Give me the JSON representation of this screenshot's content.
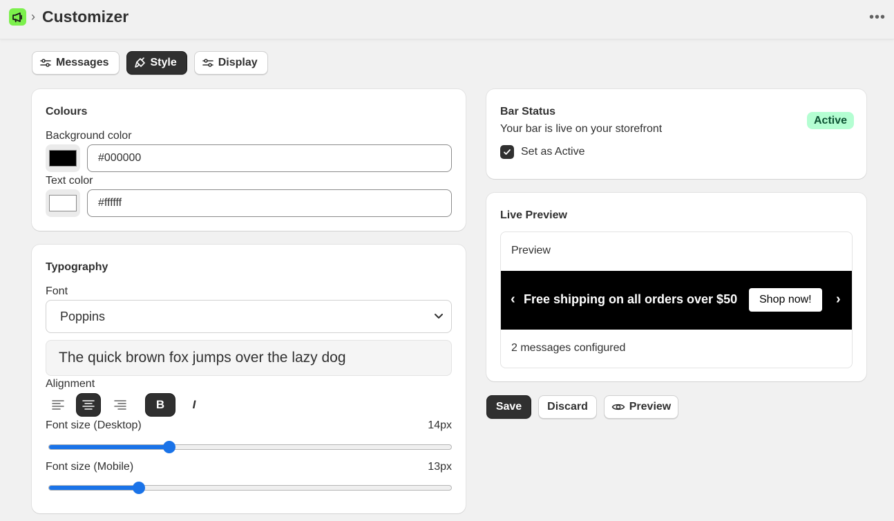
{
  "header": {
    "title": "Customizer"
  },
  "tabs": [
    {
      "label": "Messages"
    },
    {
      "label": "Style"
    },
    {
      "label": "Display"
    }
  ],
  "colours": {
    "title": "Colours",
    "background_label": "Background color",
    "background_value": "#000000",
    "text_label": "Text color",
    "text_value": "#ffffff"
  },
  "typography": {
    "title": "Typography",
    "font_label": "Font",
    "font_value": "Poppins",
    "sample_text": "The quick brown fox jumps over the lazy dog",
    "alignment_label": "Alignment",
    "alignment_selected": "center",
    "bold_label": "B",
    "italic_label": "I",
    "desktop_label": "Font size (Desktop)",
    "desktop_value": "14px",
    "desktop_fraction": 0.3,
    "mobile_label": "Font size (Mobile)",
    "mobile_value": "13px",
    "mobile_fraction": 0.225
  },
  "status": {
    "title": "Bar Status",
    "description": "Your bar is live on your storefront",
    "badge": "Active",
    "checkbox_label": "Set as Active",
    "checked": true
  },
  "preview": {
    "title": "Live Preview",
    "label": "Preview",
    "left_arrow": "‹",
    "message": "Free shipping on all orders over $50",
    "button": "Shop now!",
    "right_arrow": "›",
    "footer": "2 messages configured"
  },
  "actions": {
    "save": "Save",
    "discard": "Discard",
    "preview": "Preview"
  },
  "colors": {
    "app_icon": "#7cf04c",
    "accent": "#1a73e8",
    "badge_bg": "#b4fed2",
    "primary": "#303030"
  }
}
